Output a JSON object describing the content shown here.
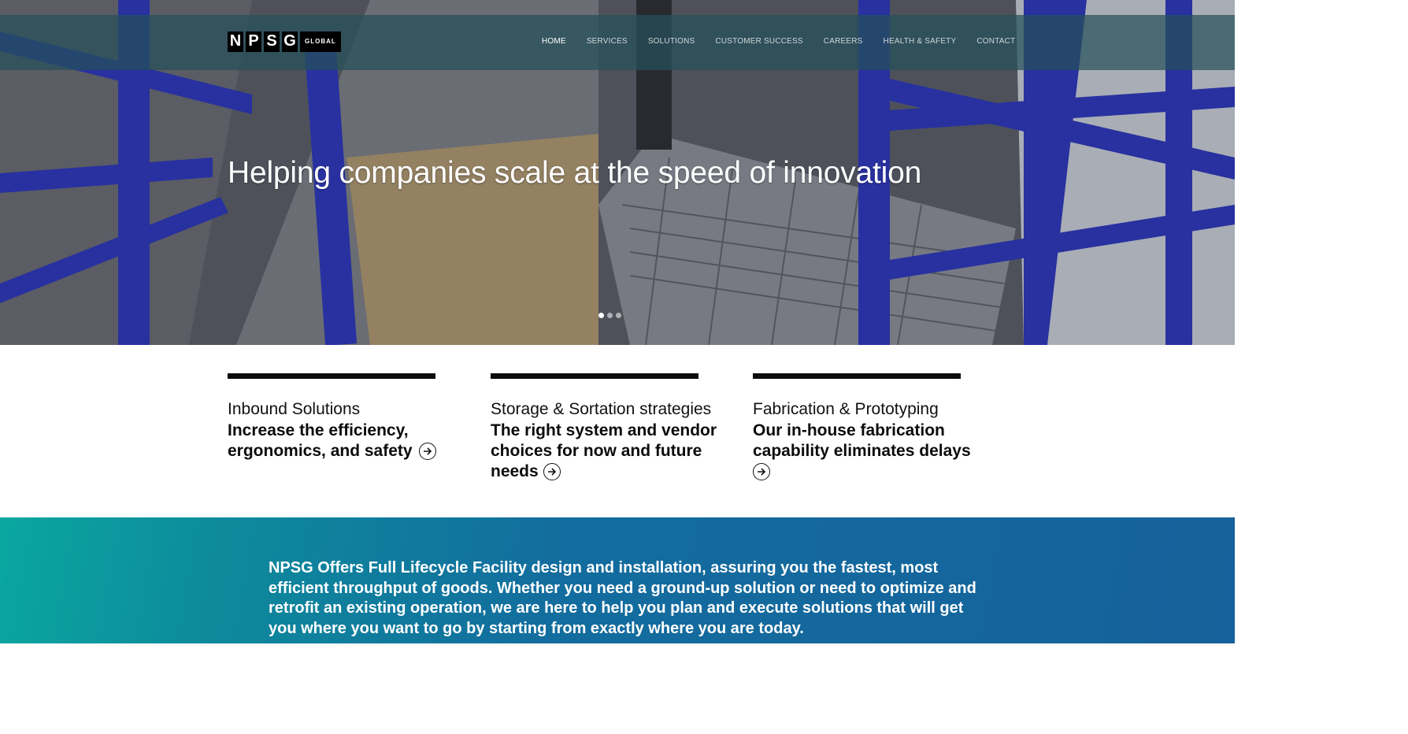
{
  "brand": {
    "logo_letters": [
      "N",
      "P",
      "S",
      "G"
    ],
    "logo_subtext": "GLOBAL"
  },
  "nav": {
    "items": [
      {
        "label": "HOME",
        "active": true
      },
      {
        "label": "SERVICES",
        "active": false
      },
      {
        "label": "SOLUTIONS",
        "active": false
      },
      {
        "label": "CUSTOMER SUCCESS",
        "active": false
      },
      {
        "label": "CAREERS",
        "active": false
      },
      {
        "label": "HEALTH & SAFETY",
        "active": false
      },
      {
        "label": "CONTACT",
        "active": false
      }
    ]
  },
  "hero": {
    "title": "Helping companies scale at the speed of innovation",
    "slides_total": 3,
    "active_slide": 1
  },
  "features": [
    {
      "kicker": "Inbound Solutions",
      "headline": "Increase the efficiency, ergonomics, and safety"
    },
    {
      "kicker": "Storage & Sortation strategies",
      "headline": "The right system and vendor choices for now and future needs"
    },
    {
      "kicker": "Fabrication & Prototyping",
      "headline": "Our in-house fabrication capability eliminates delays"
    }
  ],
  "banner": {
    "text": "NPSG Offers Full Lifecycle Facility design and installation, assuring you the fastest, most efficient throughput of goods. Whether you need a ground-up solution or need to optimize and retrofit an existing operation, we are here to help you plan and execute solutions that will get you where you want to go by starting from exactly where you are today."
  },
  "colors": {
    "nav_overlay": "#26505A",
    "banner_start": "#0AA7A0",
    "banner_end": "#16619B",
    "rack_blue": "#2B35B8"
  }
}
